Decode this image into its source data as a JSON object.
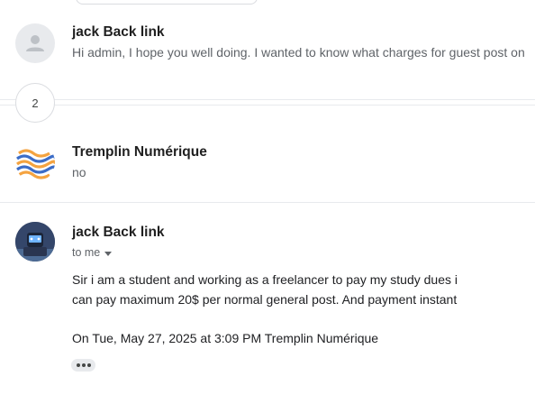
{
  "thread": {
    "collapsed_count": "2",
    "messages": [
      {
        "sender": "jack Back link",
        "snippet": "Hi admin, I hope you well doing. I wanted to know what charges for guest post on",
        "avatar_icon": "default-person-icon"
      },
      {
        "sender": "Tremplin Numérique",
        "snippet": "no",
        "avatar_icon": "orange-blue-wave-logo"
      },
      {
        "sender": "jack Back link",
        "recipient_label": "to me",
        "avatar_icon": "robot-profile-photo",
        "body_lines": [
          "Sir i am a student and working as a freelancer to pay my study dues i",
          "can pay maximum 20$ per normal general post. And payment instant"
        ],
        "quote_header": "On Tue, May 27, 2025 at 3:09 PM Tremplin Numérique"
      }
    ]
  },
  "colors": {
    "divider": "#e8eaed",
    "secondary_text": "#5f6368",
    "logo_orange": "#f4a340",
    "logo_blue": "#3b6cc7"
  }
}
